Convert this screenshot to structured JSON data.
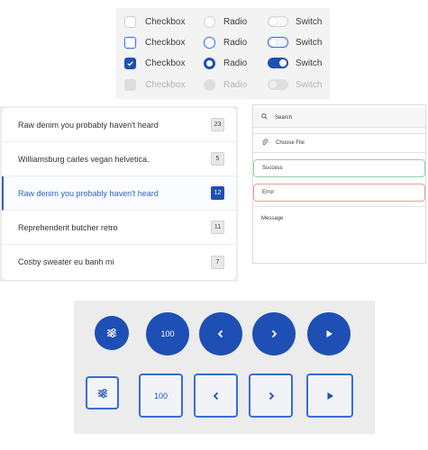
{
  "controls": {
    "rows": [
      {
        "state": "unchecked",
        "checkbox": "Checkbox",
        "radio": "Radio",
        "switch": "Switch"
      },
      {
        "state": "focused",
        "checkbox": "Checkbox",
        "radio": "Radio",
        "switch": "Switch"
      },
      {
        "state": "checked",
        "checkbox": "Checkbox",
        "radio": "Radio",
        "switch": "Switch"
      },
      {
        "state": "disabled",
        "checkbox": "Checkbox",
        "radio": "Radio",
        "switch": "Switch"
      }
    ]
  },
  "list": {
    "items": [
      {
        "label": "Raw denim you probably haven't heard",
        "count": "23"
      },
      {
        "label": "Williamsburg carles vegan helvetica.",
        "count": "5"
      },
      {
        "label": "Raw denim you probably haven't heard",
        "count": "12",
        "active": true
      },
      {
        "label": "Reprehenderit butcher retro",
        "count": "11"
      },
      {
        "label": "Cosby sweater eu banh mi",
        "count": "7"
      }
    ]
  },
  "inputs": {
    "search_placeholder": "Search",
    "file_label": "Choose File",
    "success_value": "Success",
    "error_value": "Error",
    "message_placeholder": "Message"
  },
  "buttons": {
    "round": {
      "number_label": "100"
    },
    "square": {
      "number_label": "100"
    },
    "icons": [
      "sliders-icon",
      "chevron-left-icon",
      "chevron-right-icon",
      "play-icon"
    ]
  },
  "colors": {
    "accent": "#1e4fb4",
    "success_border": "#8fd3a9",
    "error_border": "#ea9b9b"
  }
}
